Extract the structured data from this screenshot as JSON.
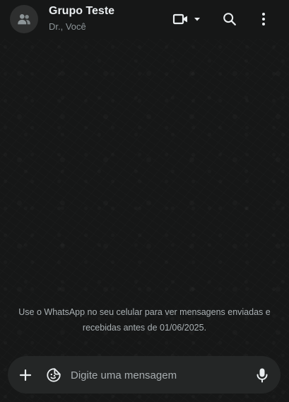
{
  "header": {
    "title": "Grupo Teste",
    "subtitle": "Dr., Você",
    "icons": {
      "avatar": "group-icon",
      "video": "video-camera-icon",
      "dropdown": "caret-down-icon",
      "search": "search-icon",
      "menu": "more-vertical-icon"
    }
  },
  "chat": {
    "notice": "Use o WhatsApp no seu celular para ver mensagens enviadas e recebidas antes de 01/06/2025."
  },
  "composer": {
    "placeholder": "Digite uma mensagem",
    "value": "",
    "icons": {
      "attach": "plus-icon",
      "sticker": "sticker-icon",
      "mic": "microphone-icon"
    }
  },
  "colors": {
    "background": "#161717",
    "composer": "#242626",
    "title": "#e9edef",
    "muted": "#8d9598"
  }
}
